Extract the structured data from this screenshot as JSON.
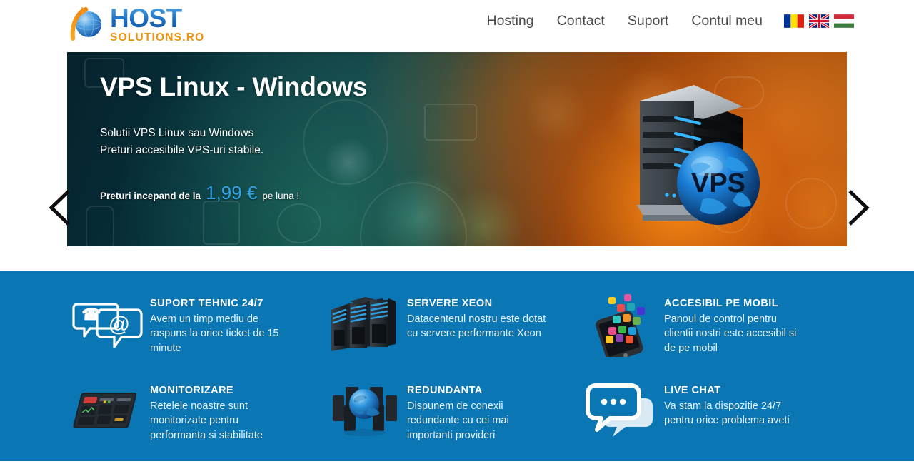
{
  "header": {
    "logo": {
      "primary": "HOST",
      "secondary": "SOLUTIONS.RO",
      "mark_icon": "globe-arrow-icon"
    },
    "nav": [
      {
        "label": "Hosting",
        "name": "nav-hosting"
      },
      {
        "label": "Contact",
        "name": "nav-contact"
      },
      {
        "label": "Suport",
        "name": "nav-suport"
      },
      {
        "label": "Contul meu",
        "name": "nav-contul-meu"
      }
    ],
    "flags": [
      {
        "name": "flag-ro",
        "title": "Romana"
      },
      {
        "name": "flag-en",
        "title": "English"
      },
      {
        "name": "flag-hu",
        "title": "Magyar"
      }
    ]
  },
  "banner": {
    "title": "VPS Linux - Windows",
    "line1": "Solutii VPS Linux sau Windows",
    "line2": "Preturi accesibile VPS-uri stabile.",
    "price_prefix": "Preturi incepand de la",
    "price_amount": "1,99 €",
    "price_suffix": "pe luna !",
    "art_label": "VPS",
    "art_icon": "server-globe-icon",
    "prev_icon": "chevron-left-icon",
    "next_icon": "chevron-right-icon"
  },
  "features": {
    "background_color": "#0a76b4",
    "items": [
      {
        "icon": "chat-email-bubbles-icon",
        "title": "SUPORT TEHNIC 24/7",
        "desc": "Avem un timp mediu de raspuns la orice ticket de 15 minute"
      },
      {
        "icon": "server-racks-icon",
        "title": "SERVERE XEON",
        "desc": "Datacenterul nostru este dotat cu servere performante Xeon"
      },
      {
        "icon": "smartphone-apps-icon",
        "title": "ACCESIBIL PE MOBIL",
        "desc": "Panoul de control pentru clientii nostri este accesibil si de pe mobil"
      },
      {
        "icon": "monitoring-dashboard-icon",
        "title": "MONITORIZARE",
        "desc": "Retelele noastre sunt monitorizate pentru performanta si stabilitate"
      },
      {
        "icon": "globe-servers-icon",
        "title": "REDUNDANTA",
        "desc": "Dispunem de conexii redundante cu cei mai importanti provideri"
      },
      {
        "icon": "live-chat-bubbles-icon",
        "title": "LIVE CHAT",
        "desc": "Va stam la dispozitie 24/7 pentru orice problema aveti"
      }
    ]
  },
  "colors": {
    "brand_blue": "#0a76b4",
    "logo_orange": "#f0920a",
    "price_blue": "#2fa3e8",
    "nav_text": "#4a4a4a"
  }
}
